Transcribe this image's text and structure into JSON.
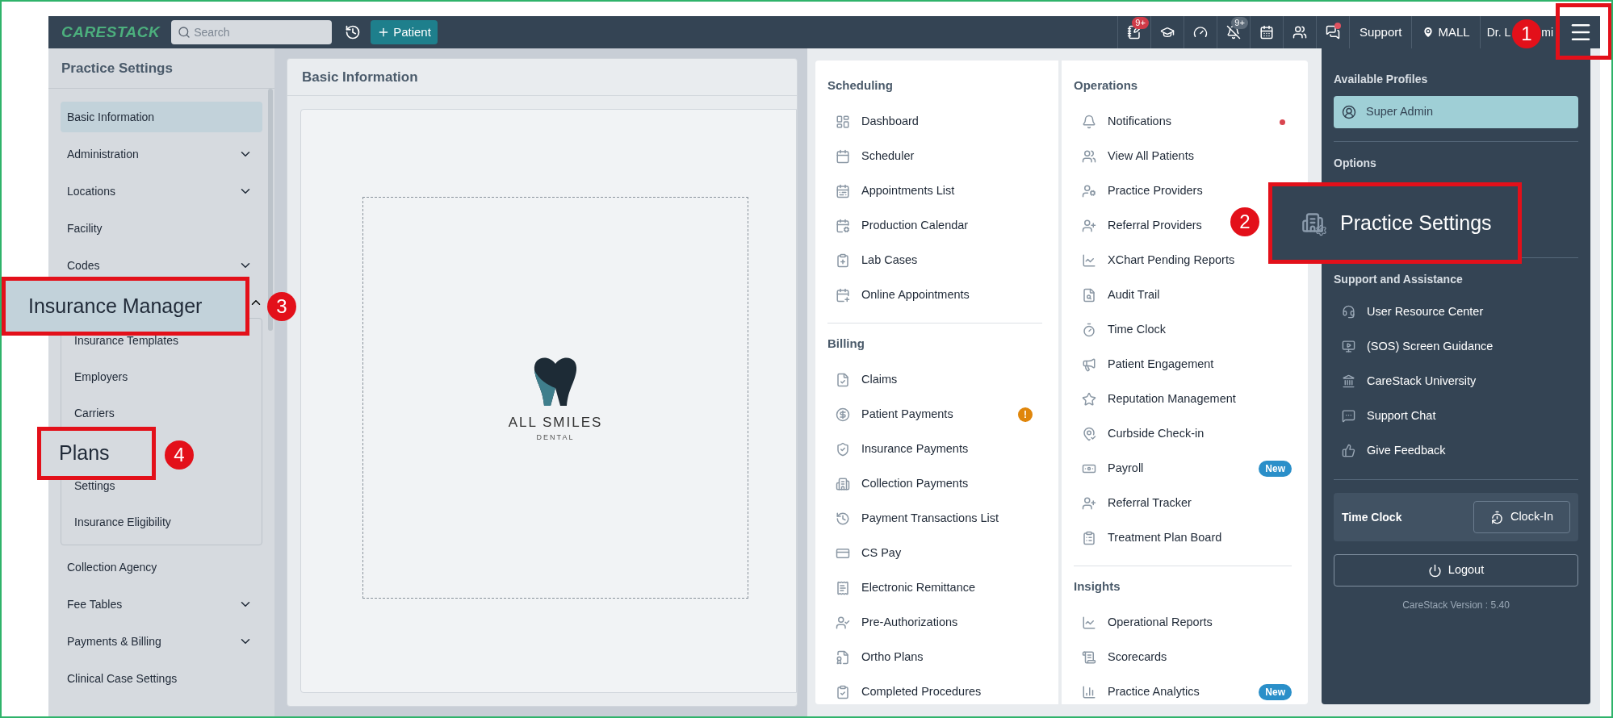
{
  "top_bar": {
    "logo": "CARESTACK",
    "search": {
      "placeholder": "Search"
    },
    "patient_button": "Patient",
    "tools": [
      {
        "badge": "9+",
        "color": "#cf3b48",
        "dot": false
      },
      {
        "dot": false
      },
      {
        "dot": false
      },
      {
        "badge": "9+",
        "color": "#5d6b79",
        "dot": false
      },
      {
        "dot": false
      },
      {
        "dot": false
      },
      {
        "dot": true
      }
    ],
    "support": "Support",
    "location": "MALL",
    "user_parts": [
      "Dr. L",
      "mi"
    ],
    "menu_callout": "1"
  },
  "sidebar": {
    "title": "Practice Settings",
    "items": [
      {
        "label": "Basic Information",
        "selected": true
      },
      {
        "label": "Administration",
        "expandable": true,
        "expanded": false,
        "selected": false
      },
      {
        "label": "Locations",
        "expandable": true,
        "expanded": false,
        "selected": false
      },
      {
        "label": "Facility",
        "selected": false
      },
      {
        "label": "Codes",
        "expandable": true,
        "expanded": false,
        "selected": false
      },
      {
        "label": "Insurance Manager",
        "callout": "3",
        "expandable": true,
        "expanded": true,
        "selected": false,
        "children": [
          {
            "label": "Insurance Templates"
          },
          {
            "label": "Employers"
          },
          {
            "label": "Carriers"
          },
          {
            "label": "Plans",
            "callout": "4"
          },
          {
            "label": "Settings"
          },
          {
            "label": "Insurance Eligibility"
          }
        ]
      },
      {
        "label": "Collection Agency",
        "selected": false
      },
      {
        "label": "Fee Tables",
        "expandable": true,
        "expanded": false,
        "selected": false
      },
      {
        "label": "Payments & Billing",
        "expandable": true,
        "expanded": false,
        "selected": false
      },
      {
        "label": "Clinical Case Settings",
        "selected": false
      }
    ]
  },
  "content": {
    "title": "Basic Information",
    "logo_name": "ALL SMILES",
    "logo_sub": "DENTAL"
  },
  "menu": {
    "columns": [
      [
        {
          "title": "Scheduling",
          "items": [
            {
              "label": "Dashboard"
            },
            {
              "label": "Scheduler"
            },
            {
              "label": "Appointments List"
            },
            {
              "label": "Production Calendar"
            },
            {
              "label": "Lab Cases"
            },
            {
              "label": "Online Appointments"
            }
          ]
        },
        {
          "title": "Billing",
          "items": [
            {
              "label": "Claims"
            },
            {
              "label": "Patient Payments",
              "badge": {
                "kind": "alert",
                "text": "!"
              }
            },
            {
              "label": "Insurance Payments"
            },
            {
              "label": "Collection Payments"
            },
            {
              "label": "Payment Transactions List"
            },
            {
              "label": "CS Pay"
            },
            {
              "label": "Electronic Remittance"
            },
            {
              "label": "Pre-Authorizations"
            },
            {
              "label": "Ortho Plans"
            },
            {
              "label": "Completed Procedures"
            }
          ]
        }
      ],
      [
        {
          "title": "Operations",
          "items": [
            {
              "label": "Notifications",
              "badge": {
                "kind": "dot"
              }
            },
            {
              "label": "View All Patients"
            },
            {
              "label": "Practice Providers"
            },
            {
              "label": "Referral Providers"
            },
            {
              "label": "XChart Pending Reports"
            },
            {
              "label": "Audit Trail"
            },
            {
              "label": "Time Clock"
            },
            {
              "label": "Patient Engagement"
            },
            {
              "label": "Reputation Management"
            },
            {
              "label": "Curbside Check-in"
            },
            {
              "label": "Payroll",
              "badge": {
                "kind": "new",
                "text": "New"
              }
            },
            {
              "label": "Referral Tracker"
            },
            {
              "label": "Treatment Plan Board"
            }
          ]
        },
        {
          "title": "Insights",
          "items": [
            {
              "label": "Operational Reports"
            },
            {
              "label": "Scorecards"
            },
            {
              "label": "Practice Analytics",
              "badge": {
                "kind": "new",
                "text": "New"
              }
            }
          ]
        }
      ]
    ]
  },
  "profile_panel": {
    "profiles_title": "Available Profiles",
    "profiles": [
      {
        "label": "Super Admin",
        "selected": true
      }
    ],
    "options_title": "Options",
    "options": [
      {
        "label": "Practice Settings",
        "callout": "2"
      }
    ],
    "support_title": "Support and Assistance",
    "support_items": [
      "User Resource Center",
      "(SOS) Screen Guidance",
      "CareStack University",
      "Support Chat",
      "Give Feedback"
    ],
    "time_clock": {
      "label": "Time Clock",
      "button": "Clock-In"
    },
    "logout": "Logout",
    "version": "CareStack Version : 5.40"
  }
}
